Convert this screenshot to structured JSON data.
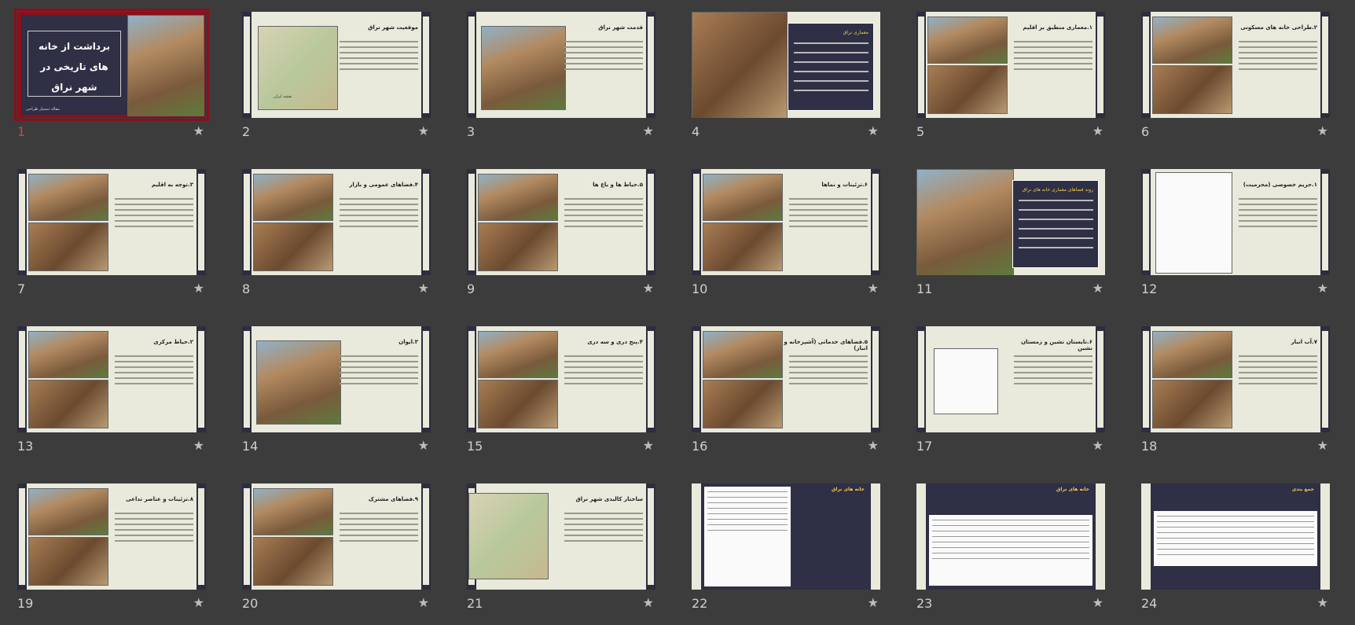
{
  "slides": [
    {
      "n": "1",
      "title": "برداشت از خانه های تاریخی در شهر نراق",
      "footer": "مقاله دستیار طراحی",
      "kind": "cover",
      "selected": true
    },
    {
      "n": "2",
      "title": "موقعیت شهر نراق",
      "map_caption": "نقشه ایران",
      "kind": "map"
    },
    {
      "n": "3",
      "title": "قدمت شهر نراق",
      "kind": "photo-left"
    },
    {
      "n": "4",
      "title": "معماری نراق",
      "kind": "vault"
    },
    {
      "n": "5",
      "title": "۱.معماری منطبق بر اقلیم",
      "kind": "photos-left"
    },
    {
      "n": "6",
      "title": "۲.طراحی خانه های مسکونی",
      "kind": "photos-left"
    },
    {
      "n": "7",
      "title": "۳.توجه به اقلیم",
      "kind": "photos-left"
    },
    {
      "n": "8",
      "title": "۴.فضاهای عمومی و بازار",
      "kind": "photos-left"
    },
    {
      "n": "9",
      "title": "۵.حیاط ها و باغ ها",
      "kind": "photos-left"
    },
    {
      "n": "10",
      "title": "۶.تزئینات و نماها",
      "kind": "photos-left"
    },
    {
      "n": "11",
      "title": "روند فضاهای معماری خانه های نراق",
      "kind": "photo-dark"
    },
    {
      "n": "12",
      "title": "۱.حریم خصوصی (محرمیت)",
      "kind": "plan"
    },
    {
      "n": "13",
      "title": "۲.حیاط مرکزی",
      "kind": "photos-left"
    },
    {
      "n": "14",
      "title": "۳.ایوان",
      "kind": "photo-left"
    },
    {
      "n": "15",
      "title": "۴.پنج دری و سه دری",
      "kind": "photos-left"
    },
    {
      "n": "16",
      "title": "۵.فضاهای خدماتی (آشپزخانه و انبار)",
      "kind": "photos-left"
    },
    {
      "n": "17",
      "title": "۶.تابستان نشین و زمستان نشین",
      "kind": "plan"
    },
    {
      "n": "18",
      "title": "۷.آب انبار",
      "kind": "photos-left"
    },
    {
      "n": "19",
      "title": "۸.تزئینات و عناصر تداعی",
      "kind": "photos-left"
    },
    {
      "n": "20",
      "title": "۹.فضاهای مشترک",
      "kind": "photos-left"
    },
    {
      "n": "21",
      "title": "ساختار کالبدی شهر نراق",
      "kind": "map-left"
    },
    {
      "n": "22",
      "title": "خانه های نراق",
      "kind": "dark-plans"
    },
    {
      "n": "23",
      "title": "خانه های نراق",
      "kind": "dark-plans-wide"
    },
    {
      "n": "24",
      "title": "جمع بندی",
      "kind": "dark-table"
    }
  ],
  "star_glyph": "★",
  "colors": {
    "background": "#3c3c3c",
    "slide": "#e9e9dc",
    "dark": "#2f2f45",
    "selected": "#8b0f1c"
  }
}
